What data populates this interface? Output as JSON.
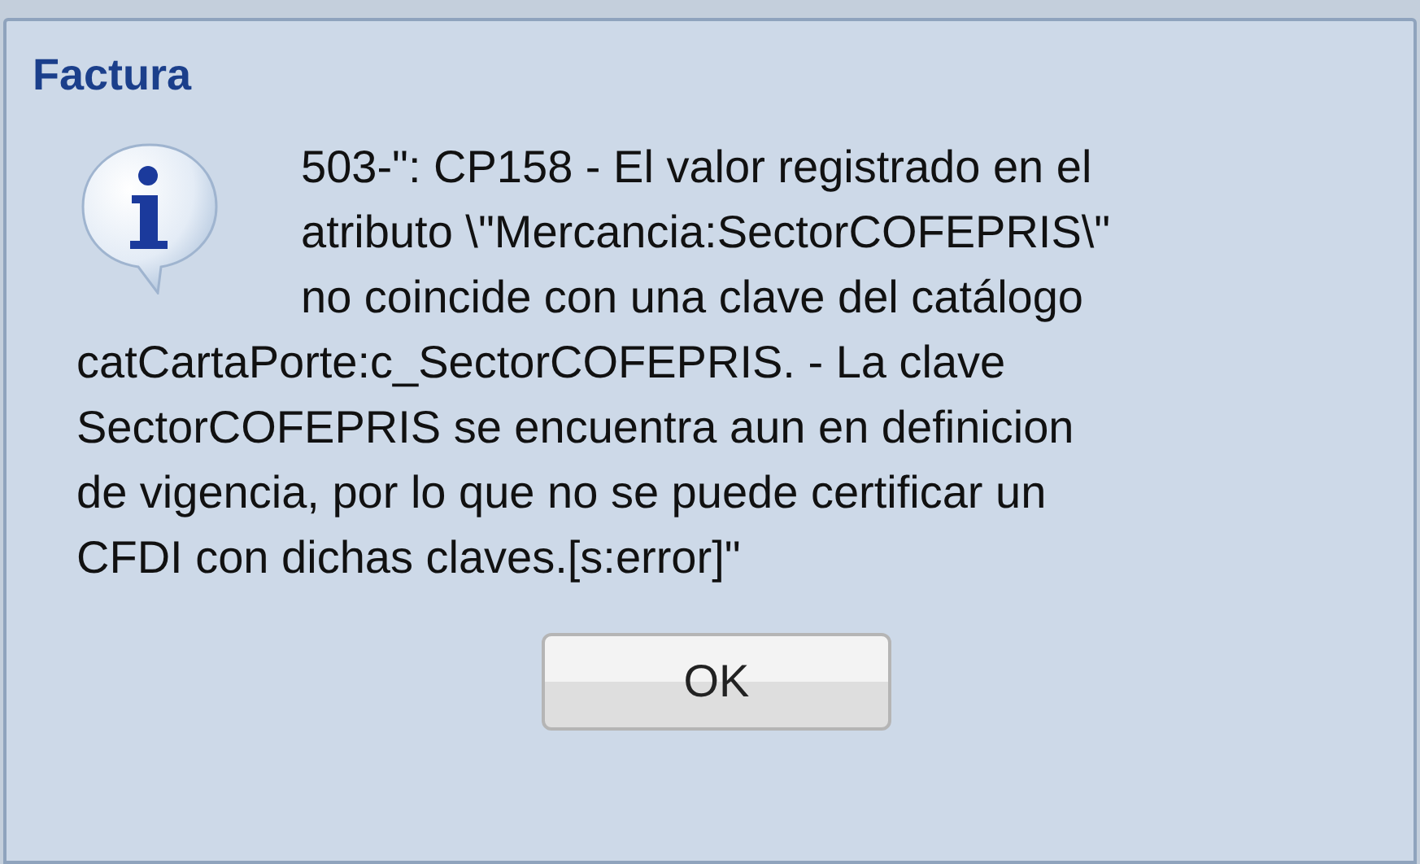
{
  "dialog": {
    "title": "Factura",
    "message_lines": [
      "503-\": CP158 - El valor registrado en el",
      "atributo \\\"Mercancia:SectorCOFEPRIS\\\"",
      "no coincide con una clave del catálogo",
      "catCartaPorte:c_SectorCOFEPRIS. - La clave",
      "SectorCOFEPRIS se encuentra aun en definicion",
      "de vigencia, por lo que no se puede certificar un",
      "CFDI con dichas claves.[s:error]\""
    ],
    "buttons": [
      "OK"
    ]
  }
}
